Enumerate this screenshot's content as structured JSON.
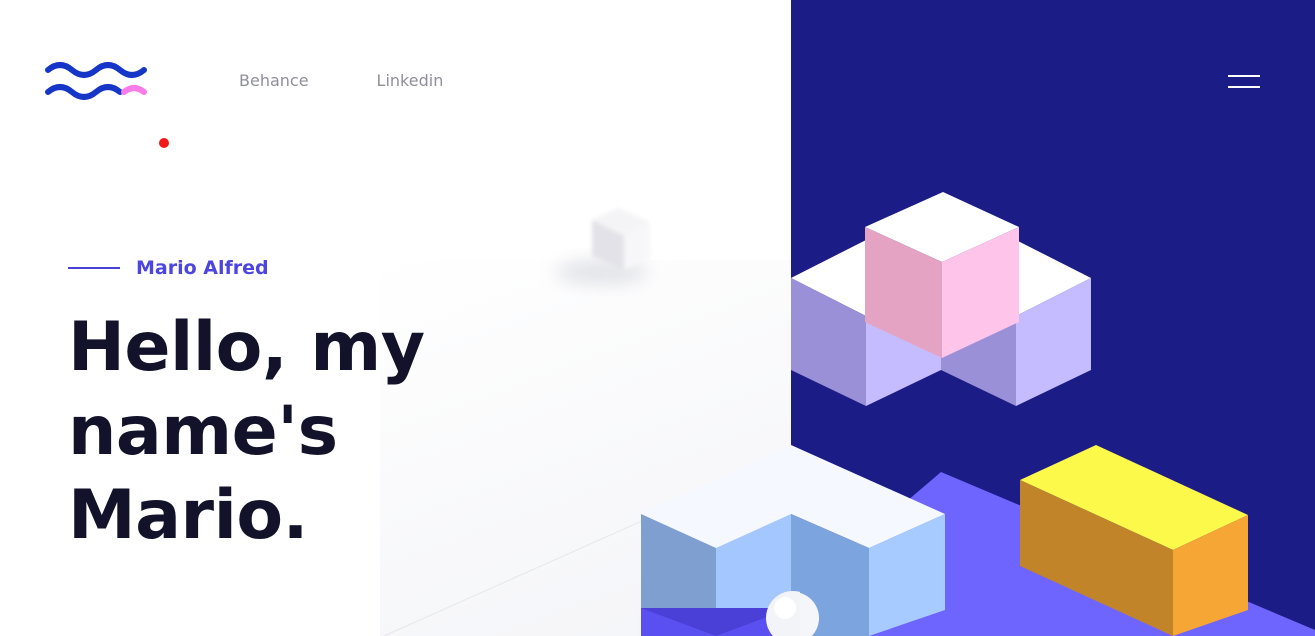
{
  "brand": {
    "logo_icon": "wave-logo-icon",
    "primary_color": "#1636c8",
    "accent_color": "#f97be8"
  },
  "nav": {
    "links": [
      {
        "label": "Behance"
      },
      {
        "label": "Linkedin"
      }
    ],
    "menu_icon": "hamburger-menu-icon"
  },
  "hero": {
    "eyebrow": "Mario Alfred",
    "headline_lines": [
      "Hello, my",
      "name's",
      "Mario."
    ],
    "panel_color": "#1c1c87",
    "illustration": "isometric-blocks-illustration"
  },
  "colors": {
    "text_dark": "#12132a",
    "eyebrow": "#4d45e0",
    "nav_text": "#8f8f9b",
    "cursor_dot": "#f21818"
  }
}
